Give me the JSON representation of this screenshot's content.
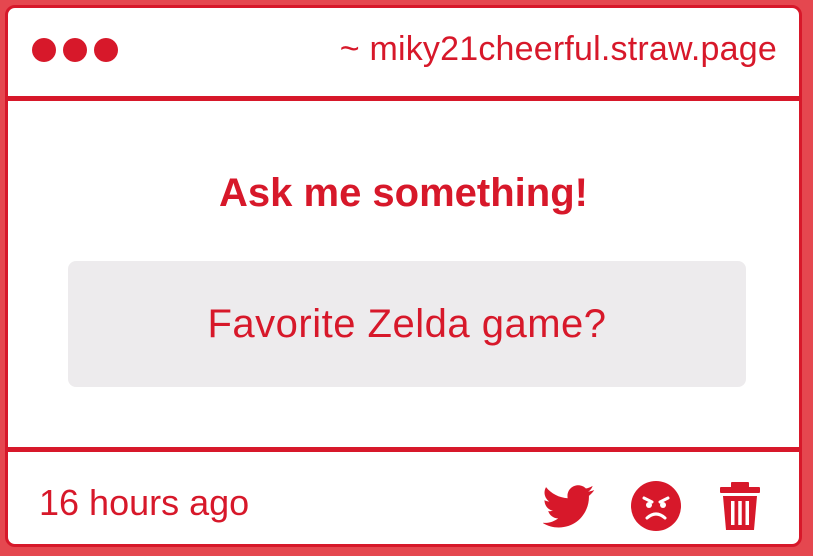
{
  "window": {
    "url": "~ miky21cheerful.straw.page"
  },
  "main": {
    "heading": "Ask me something!",
    "question": "Favorite Zelda game?"
  },
  "footer": {
    "timestamp": "16 hours ago",
    "icons": [
      "twitter-icon",
      "angry-face-icon",
      "trash-icon"
    ]
  },
  "colors": {
    "accent": "#d7182a",
    "outer_background": "#e5474f",
    "question_box": "#edebed",
    "card_background": "#ffffff"
  }
}
